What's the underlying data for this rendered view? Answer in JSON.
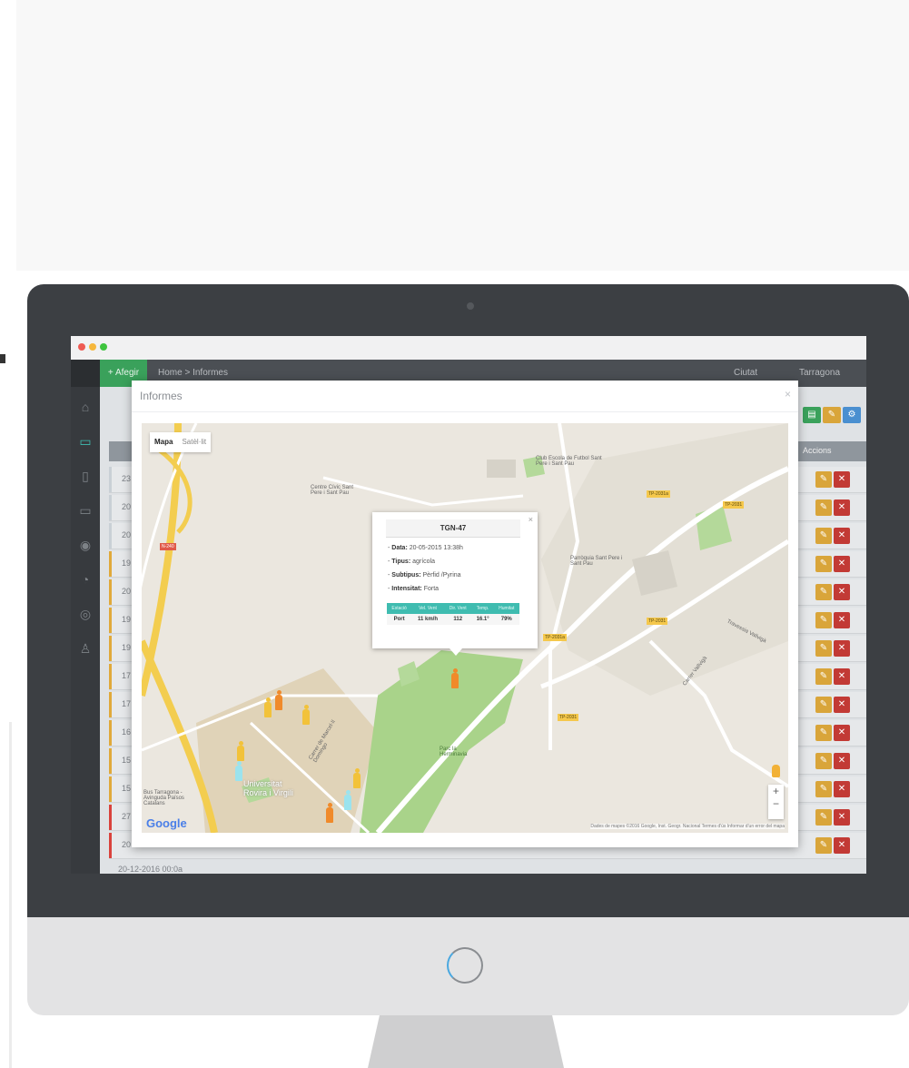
{
  "app": {
    "browser_dots": [
      "#ee5a52",
      "#f6b73c",
      "#3ec43e"
    ]
  },
  "topnav": {
    "button_label": "+ Afegir",
    "breadcrumb": "Home > Informes",
    "user_menu": "Ciutat",
    "location_menu": "Tarragona"
  },
  "sidebar": {
    "items": [
      {
        "icon": "home-icon"
      },
      {
        "icon": "inbox-icon"
      },
      {
        "icon": "mobile-icon"
      },
      {
        "icon": "card-icon"
      },
      {
        "icon": "map-pin-icon"
      },
      {
        "icon": "rss-icon"
      },
      {
        "icon": "location-icon"
      },
      {
        "icon": "users-icon"
      }
    ]
  },
  "table": {
    "header_label": "Accions",
    "rows": [
      {
        "text": "23",
        "bar": "#c9d0d6"
      },
      {
        "text": "20",
        "bar": "#c9d0d6"
      },
      {
        "text": "20",
        "bar": "#c9d0d6"
      },
      {
        "text": "19",
        "bar": "#e0a93a"
      },
      {
        "text": "20",
        "bar": "#e0a93a"
      },
      {
        "text": "19",
        "bar": "#e0a93a"
      },
      {
        "text": "19",
        "bar": "#e0a93a"
      },
      {
        "text": "17",
        "bar": "#e0a93a"
      },
      {
        "text": "17",
        "bar": "#e0a93a"
      },
      {
        "text": "16",
        "bar": "#e0a93a"
      },
      {
        "text": "15",
        "bar": "#e0a93a"
      },
      {
        "text": "15",
        "bar": "#e0a93a"
      },
      {
        "text": "27",
        "bar": "#d9423c"
      },
      {
        "text": "20",
        "bar": "#d9423c"
      }
    ],
    "last_row": "20-12-2016 00:0a"
  },
  "modal": {
    "title": "Informes",
    "close": "×"
  },
  "map": {
    "tabs": [
      "Mapa",
      "Satèl·lit"
    ],
    "labels": {
      "centre_civic": "Centre Cívic Sant Pere i Sant Pau",
      "club": "Club Escola de Futbol Sant Pere i Sant Pau",
      "parroquia": "Parròquia Sant Pere i Sant Pau",
      "universitat": "Universitat Rovira i Virgili",
      "parc": "Parc la Herminavia",
      "carrer_1": "Carrer de Marcel·lí Domingo",
      "carrer_2": "Travessia Vallvigà",
      "carrer_3": "Carrer Vallvigà",
      "bus_stop": "Bus Tarragona - Avinguda Països Catalans"
    },
    "road_labels": [
      "TP-2031a",
      "TP-2031",
      "TP-2031",
      "TP-2031a",
      "TP-2031",
      "N-240"
    ],
    "attribution": "Dades de mapes ©2016 Google, Inst. Geogr. Nacional   Termes d'ús   Informar d'un error del mapa",
    "google": "Google",
    "zoom_in": "+",
    "zoom_out": "−"
  },
  "popup": {
    "title": "TGN-47",
    "close": "×",
    "data_label": "Data:",
    "data_value": "20-05-2015 13:38h",
    "tipus_label": "Tipus:",
    "tipus_value": "agrícola",
    "subtipus_label": "Subtipus:",
    "subtipus_value": "Pèrfid /Pyrina",
    "intensitat_label": "Intensitat:",
    "intensitat_value": "Forta",
    "table_headers": [
      "Estació",
      "Vel. Vent",
      "Dir. Vent",
      "Temp.",
      "Humitat"
    ],
    "table_values": [
      "Port",
      "11 km/h",
      "112",
      "16.1°",
      "79%"
    ]
  },
  "colors": {
    "accent_green": "#3aa15b",
    "edit": "#d9a53a",
    "delete": "#c23a35",
    "teal": "#3fbcb0"
  }
}
